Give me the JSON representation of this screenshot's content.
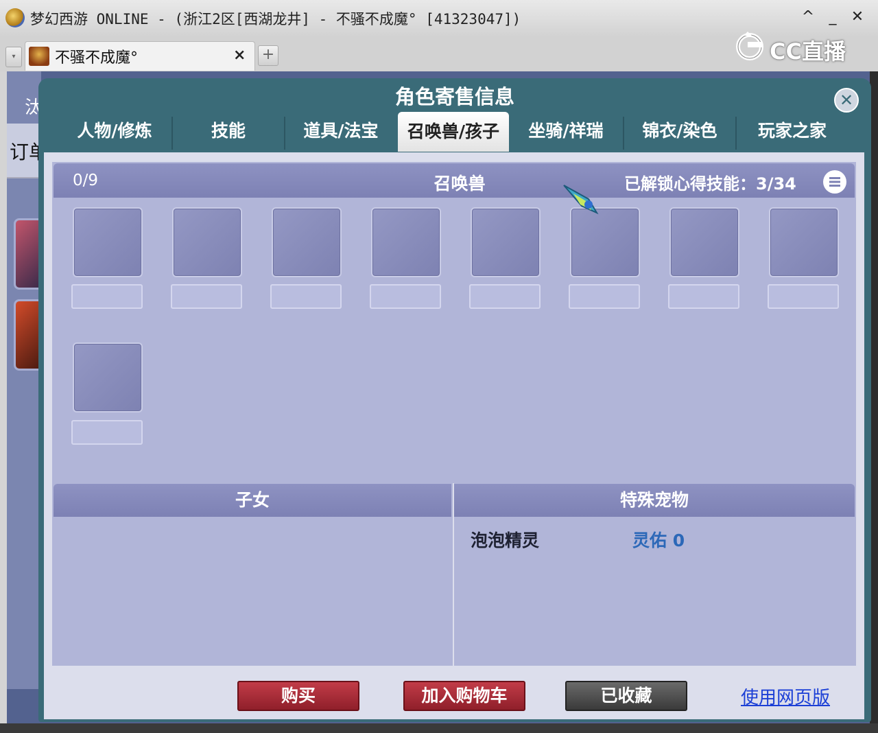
{
  "window": {
    "title": "梦幻西游 ONLINE - (浙江2区[西湖龙井] - 不骚不成魔° [41323047])",
    "controls": {
      "up": "^",
      "minimize": "_",
      "close": "✕"
    }
  },
  "tab_bar": {
    "menu_glyph": "▾",
    "active_tab": "不骚不成魔°",
    "tab_close": "×",
    "new_tab": "+"
  },
  "brand": {
    "label": "CC直播"
  },
  "left_strip": {
    "text1": "汰",
    "text2": "订单"
  },
  "dialog": {
    "title": "角色寄售信息",
    "close_glyph": "✕",
    "tabs": [
      {
        "label": "人物/修炼"
      },
      {
        "label": "技能"
      },
      {
        "label": "道具/法宝"
      },
      {
        "label": "召唤兽/孩子"
      },
      {
        "label": "坐骑/祥瑞"
      },
      {
        "label": "锦衣/染色"
      },
      {
        "label": "玩家之家"
      }
    ],
    "active_tab_index": 3
  },
  "summon": {
    "count": "0/9",
    "title": "召唤兽",
    "unlocked_skills": "已解锁心得技能：3/34"
  },
  "children": {
    "title": "子女"
  },
  "special_pets": {
    "title": "特殊宠物",
    "items": [
      {
        "name": "泡泡精灵",
        "value": "灵佑 0"
      }
    ]
  },
  "actions": {
    "buy": "购买",
    "add_to_cart": "加入购物车",
    "favorited": "已收藏",
    "web_version": "使用网页版"
  }
}
